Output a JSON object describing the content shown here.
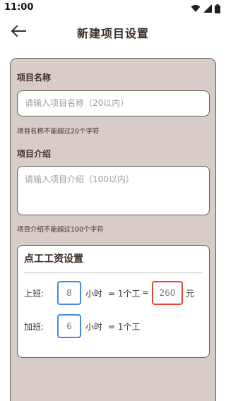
{
  "status_bar": {
    "time": "11:00",
    "icons": [
      "wifi-icon",
      "signal-icon",
      "battery-icon"
    ]
  },
  "header": {
    "back_icon": "arrow-left-icon",
    "title": "新建项目设置"
  },
  "form": {
    "name_label": "项目名称",
    "name_placeholder": "请输入项目名称（20以内）",
    "name_hint": "项目名称不能超过20个字符",
    "intro_label": "项目介绍",
    "intro_placeholder": "请输入项目介绍（100以内）",
    "intro_hint": "项目介绍不能超过100个字符"
  },
  "wage": {
    "title": "点工工资设置",
    "work_label": "上班:",
    "work_hours": "8",
    "hours_unit": "小时",
    "equals_one_shift": "= 1个工",
    "equals": "=",
    "wage_amount": "260",
    "currency": "元",
    "overtime_label": "加班:",
    "overtime_hours": "6",
    "overtime_hours_unit": "小时",
    "overtime_equals_one_shift": "= 1个工"
  },
  "colors": {
    "card_background": "#d7ccc8",
    "border": "#6d5a50",
    "text": "#3a2e28",
    "hour_box_border": "#4a86e8",
    "wage_box_border": "#e0453a"
  }
}
